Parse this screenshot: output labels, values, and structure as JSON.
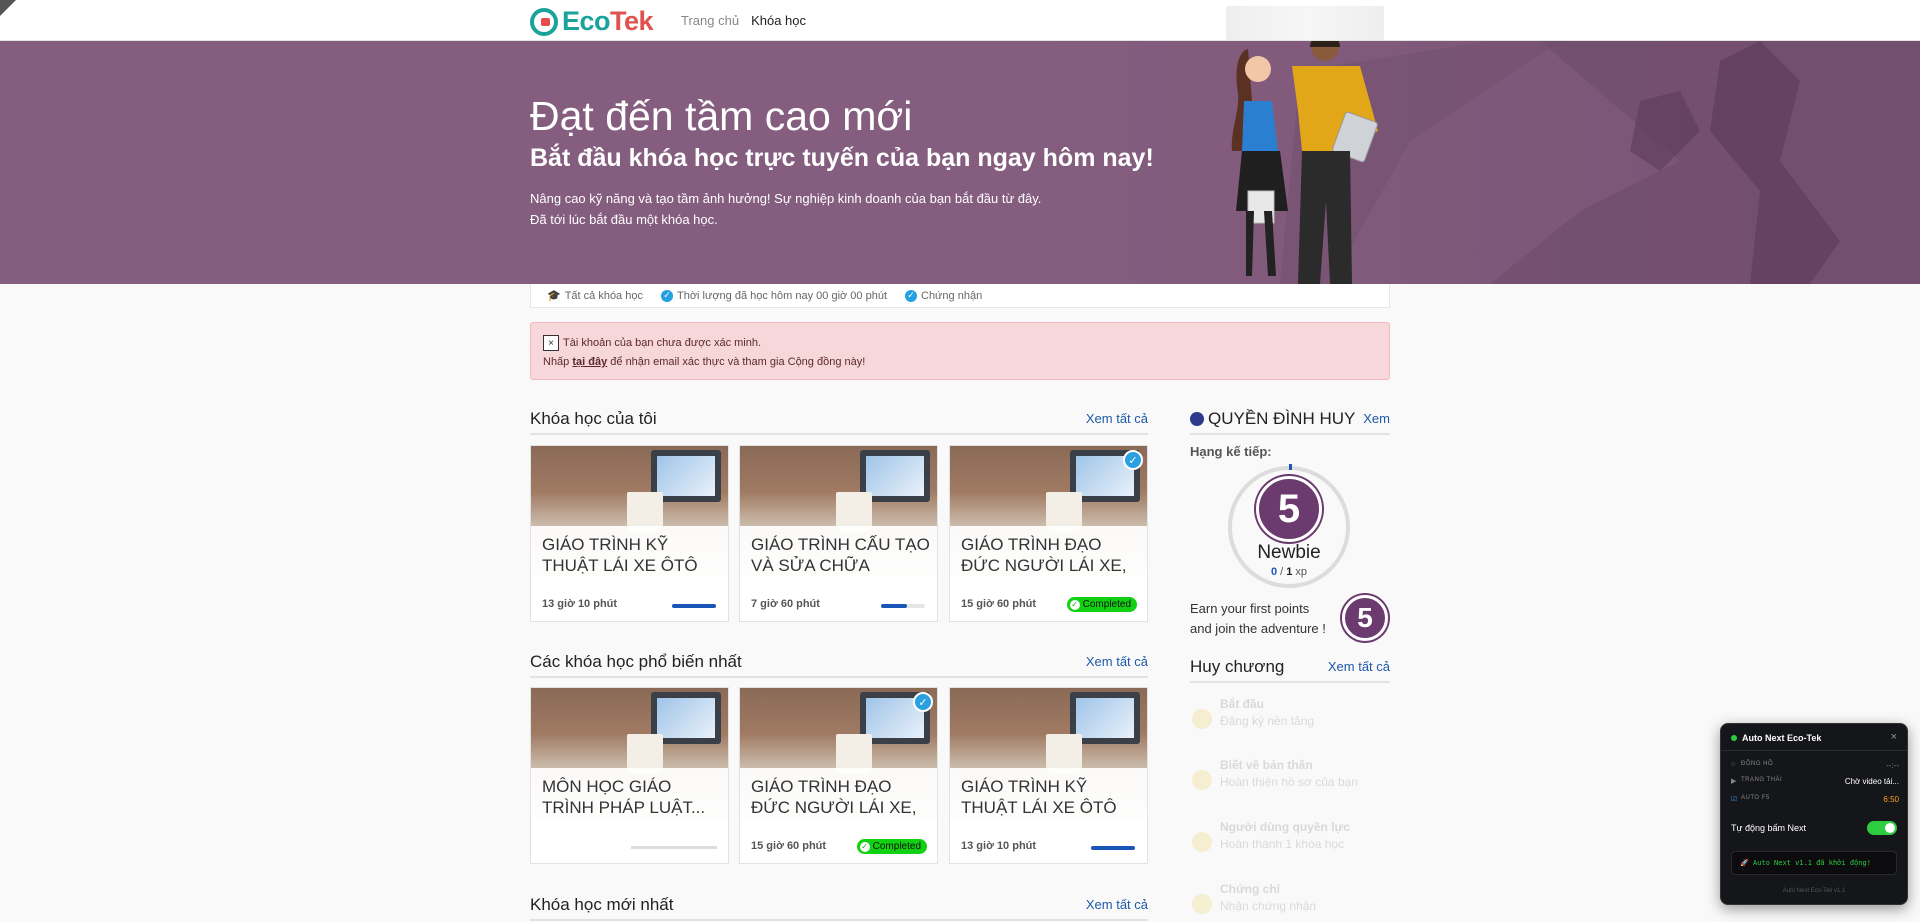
{
  "brand": {
    "eco": "Eco",
    "tek": "Tek"
  },
  "nav": {
    "home": "Trang chủ",
    "courses": "Khóa học"
  },
  "hero": {
    "title": "Đạt đến tầm cao mới",
    "subtitle": "Bắt đầu khóa học trực tuyến của bạn ngay hôm nay!",
    "line1": "Nâng cao kỹ năng và tạo tầm ảnh hưởng! Sự nghiệp kinh doanh của bạn bắt đầu từ đây.",
    "line2": "Đã tới lúc bắt đầu một khóa học."
  },
  "strip": {
    "all_courses": "Tất cả khóa học",
    "study_time": "Thời lượng đã học hôm nay 00 giờ 00 phút",
    "certificates": "Chứng nhận"
  },
  "alert": {
    "close": "×",
    "line1": "Tài khoản của bạn chưa được xác minh.",
    "line2_prefix": "Nhấp ",
    "line2_link": "tại đây",
    "line2_suffix": " để nhận email xác thực và tham gia Cộng đồng này!"
  },
  "sections": {
    "my_courses": {
      "title": "Khóa học của tôi",
      "more": "Xem tất cả"
    },
    "popular": {
      "title": "Các khóa học phổ biến nhất",
      "more": "Xem tất cả"
    },
    "newest": {
      "title": "Khóa học mới nhất",
      "more": "Xem tất cả"
    }
  },
  "my_courses": [
    {
      "title": "GIÁO TRÌNH KỸ THUẬT LÁI XE ÔTÔ",
      "duration": "13 giờ 10 phút",
      "progress": 1.0,
      "completed": false
    },
    {
      "title": "GIÁO TRÌNH CẤU TẠO VÀ SỬA CHỮA THÔN...",
      "duration": "7 giờ 60 phút",
      "progress": 0.6,
      "completed": false
    },
    {
      "title": "GIÁO TRÌNH ĐẠO ĐỨC NGƯỜI LÁI XE, VĂN...",
      "duration": "15 giờ 60 phút",
      "completed": true,
      "badge": "Completed"
    }
  ],
  "popular_courses": [
    {
      "title": "MÔN HỌC GIÁO TRÌNH PHÁP LUẬT...",
      "duration": "",
      "progress": 0.0
    },
    {
      "title": "GIÁO TRÌNH ĐẠO ĐỨC NGƯỜI LÁI XE, VĂN...",
      "duration": "15 giờ 60 phút",
      "completed": true,
      "badge": "Completed"
    },
    {
      "title": "GIÁO TRÌNH KỸ THUẬT LÁI XE ÔTÔ",
      "duration": "13 giờ 10 phút",
      "progress": 1.0
    }
  ],
  "profile": {
    "name": "QUYỀN ĐÌNH HUY",
    "more": "Xem",
    "next_rank_label": "Hạng kế tiếp:",
    "level": "5",
    "rank": "Newbie",
    "xp_current": "0",
    "xp_sep": " / ",
    "xp_target": "1",
    "xp_unit": " xp",
    "earn_line1": "Earn your first points",
    "earn_line2": "and join the adventure !"
  },
  "medals": {
    "title": "Huy chương",
    "more": "Xem tất cả",
    "items": [
      {
        "title": "Bắt đầu",
        "desc": "Đăng ký nền tảng"
      },
      {
        "title": "Biết về bản thân",
        "desc": "Hoàn thiện hồ sơ của bạn"
      },
      {
        "title": "Người dùng quyền lực",
        "desc": "Hoàn thành 1 khóa học"
      },
      {
        "title": "Chứng chỉ",
        "desc": "Nhận chứng nhận"
      }
    ]
  },
  "extension": {
    "title": "Auto Next Eco-Tek",
    "close": "×",
    "clock_label": "ĐỒNG HỒ",
    "clock_value": "--:--",
    "status_label": "TRẠNG THÁI",
    "status_value": "Chờ video tải...",
    "f5_label": "AUTO F5",
    "f5_value": "6:50",
    "toggle_label": "Tự động bấm Next",
    "log": "Auto Next v1.1 đã khởi động!",
    "footer": "Auto Next Eco-Tek v1.1"
  },
  "colors": {
    "hero_bg": "#845d7f",
    "accent_blue": "#1e5aa8",
    "level_purple": "#6b3a6e",
    "completed_green": "#12d012",
    "alert_bg": "#f7d7da"
  }
}
